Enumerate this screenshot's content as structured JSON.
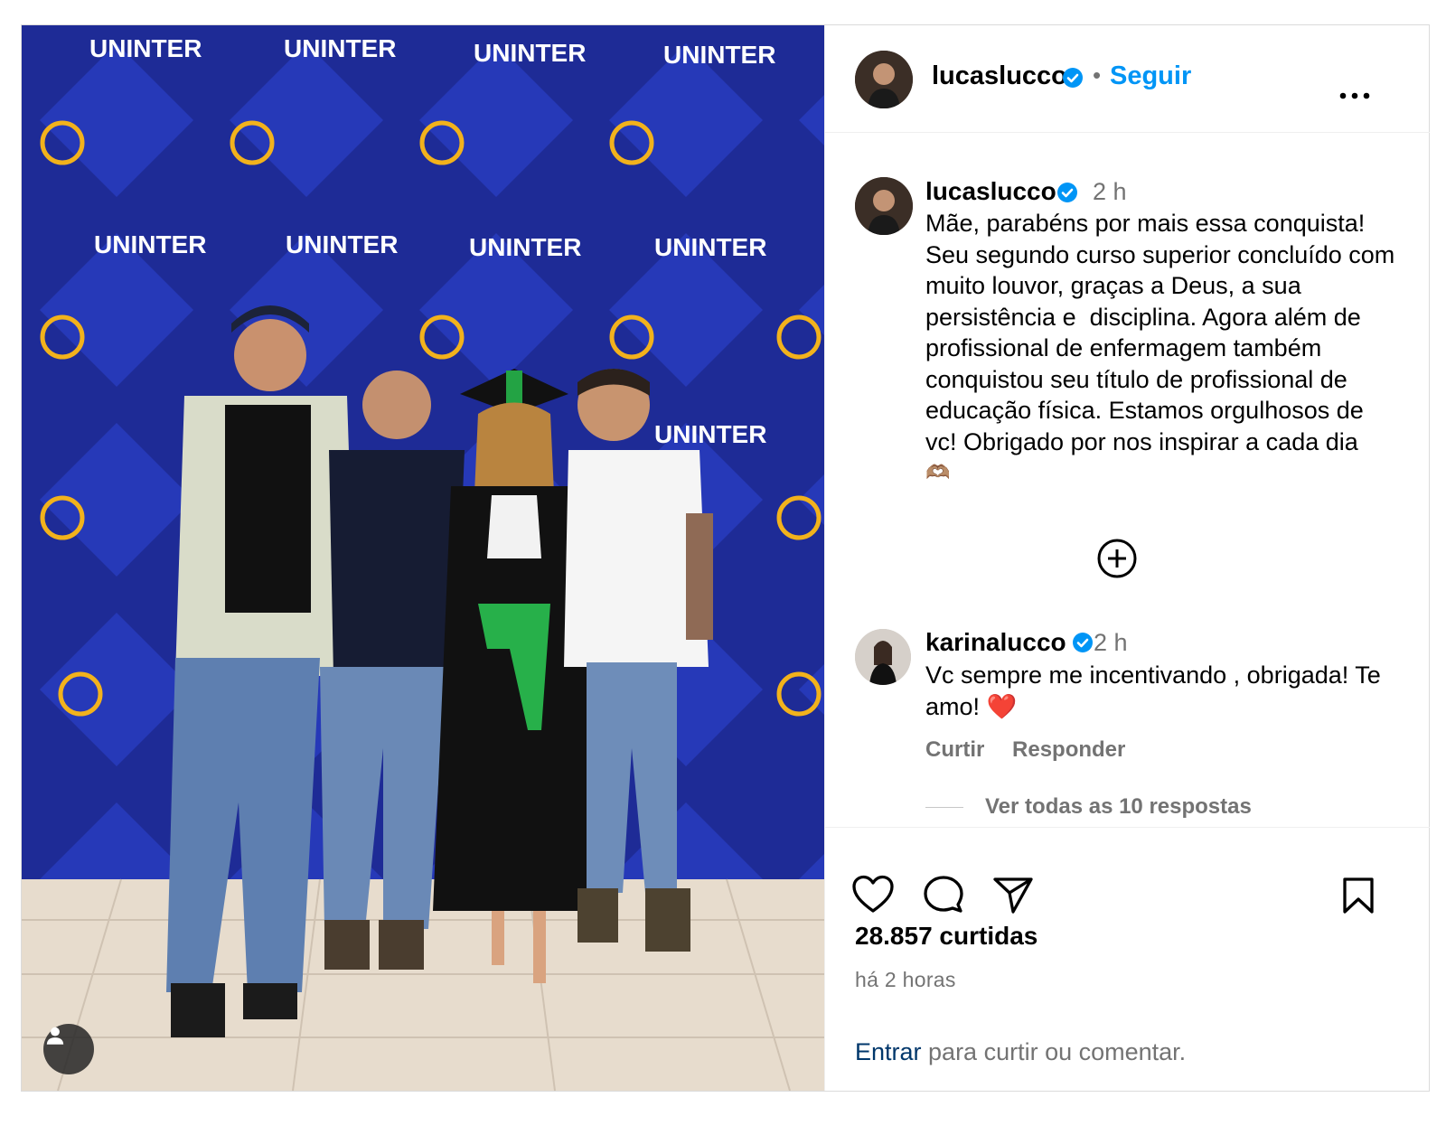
{
  "post": {
    "brand_color": "#0095f6",
    "photo": {
      "backdrop_text": "UNINTER",
      "backdrop_color": "#1f2f9e",
      "logo_color": "#f2b21c"
    },
    "header": {
      "username": "lucaslucco",
      "separator": "•",
      "follow_label": "Seguir"
    },
    "caption": {
      "username": "lucaslucco",
      "time": "2 h",
      "text": "Mãe, parabéns por mais essa conquista! Seu segundo curso superior concluído com muito louvor, graças a Deus, a sua persistência e  disciplina. Agora além de profissional de enfermagem também conquistou seu título de profissional de educação física. Estamos orgulhosos de vc! Obrigado por nos inspirar a cada dia",
      "emoji": "🫶🏽"
    },
    "comment": {
      "username": "karinalucco",
      "time": "2 h",
      "text": "Vc sempre me incentivando , obrigada! Te amo! ❤️",
      "like_label": "Curtir",
      "reply_label": "Responder",
      "view_replies": "Ver todas as 10 respostas"
    },
    "stats": {
      "likes": "28.857 curtidas",
      "posted": "há 2 horas"
    },
    "login_prompt": {
      "link": "Entrar",
      "rest": " para curtir ou comentar."
    },
    "icons": {
      "like": "heart-icon",
      "comment": "comment-icon",
      "share": "share-icon",
      "save": "bookmark-icon",
      "more": "more-icon",
      "load_more": "plus-circle-icon",
      "verified": "verified-badge-icon",
      "tagged": "user-tag-icon"
    }
  }
}
